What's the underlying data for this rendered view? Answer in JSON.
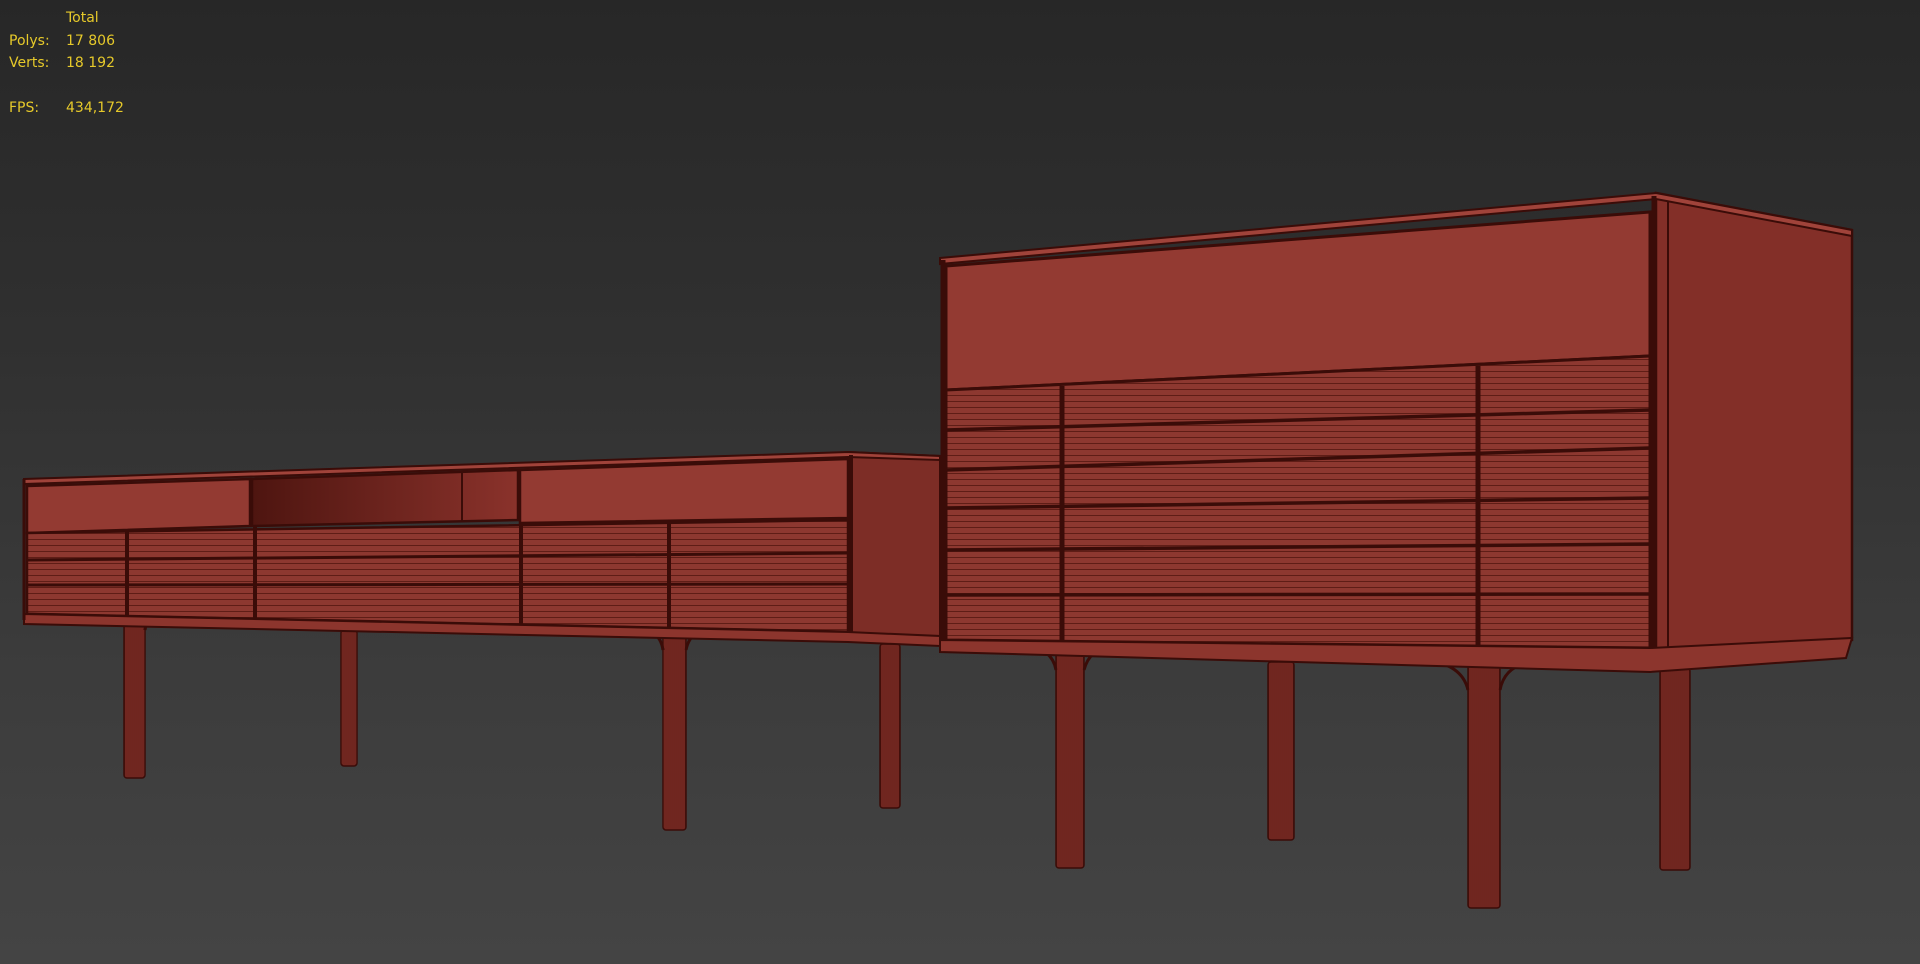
{
  "viewport": {
    "stats": {
      "header": "Total",
      "polys_label": "Polys:",
      "polys_value": "17 806",
      "verts_label": "Verts:",
      "verts_value": "18 192",
      "fps_label": "FPS:",
      "fps_value": "434,172"
    },
    "colors": {
      "background_top": "#272727",
      "background_bottom": "#444444",
      "stats_text": "#e6c92a",
      "model_face": "#8f3830",
      "model_face_dark": "#7a2c25",
      "wireframe": "#3a0c08"
    },
    "model": {
      "objects": [
        "low-sideboard",
        "tall-sideboard"
      ]
    }
  }
}
